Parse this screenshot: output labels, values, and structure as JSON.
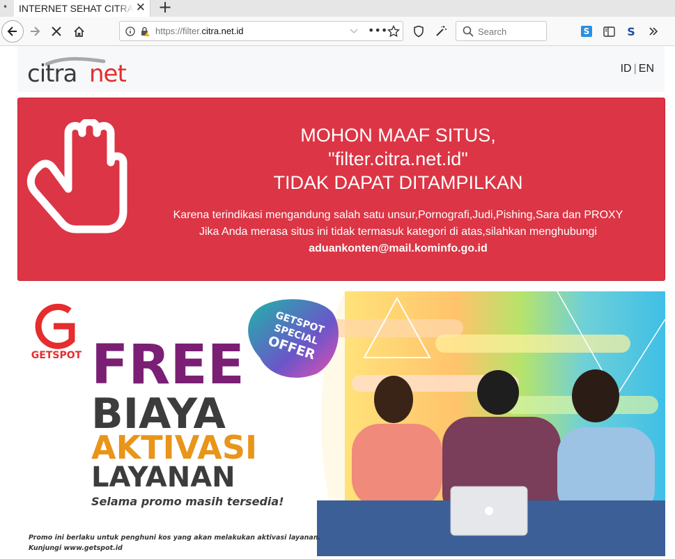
{
  "browser": {
    "tab_title": "INTERNET SEHAT CITRANET",
    "url_prefix": "https://filter.",
    "url_domain": "citra.net.id",
    "search_placeholder": "Search"
  },
  "header": {
    "logo_text": "citranet",
    "lang_id": "ID",
    "lang_sep": "|",
    "lang_en": "EN"
  },
  "alert": {
    "line1": "MOHON MAAF SITUS,",
    "line2": "\"filter.citra.net.id\"",
    "line3": "TIDAK DAPAT DITAMPILKAN",
    "reason": "Karena terindikasi mengandung salah satu unsur,Pornografi,Judi,Pishing,Sara dan PROXY",
    "contact": "Jika Anda merasa situs ini tidak termasuk kategori di atas,silahkan menghubungi",
    "email": "aduankonten@mail.kominfo.go.id",
    "icon": "stop-hand-icon"
  },
  "banner": {
    "brand": "GETSPOT",
    "badge_line1": "GETSPOT",
    "badge_line2": "SPECIAL",
    "badge_line3": "OFFER",
    "headline1": "FREE",
    "headline2": "BIAYA",
    "headline3": "AKTIVASI",
    "headline4": "LAYANAN",
    "tagline": "Selama promo masih tersedia!",
    "fine1": "Promo ini berlaku untuk penghuni kos yang akan melakukan aktivasi layanan.",
    "fine2": "Kunjungi www.getspot.id"
  },
  "colors": {
    "alert": "#dc3545",
    "brand_red": "#e52d2d",
    "headline_purple": "#7a1f73",
    "headline_dark": "#3c3c3c",
    "headline_orange": "#e8951a"
  }
}
